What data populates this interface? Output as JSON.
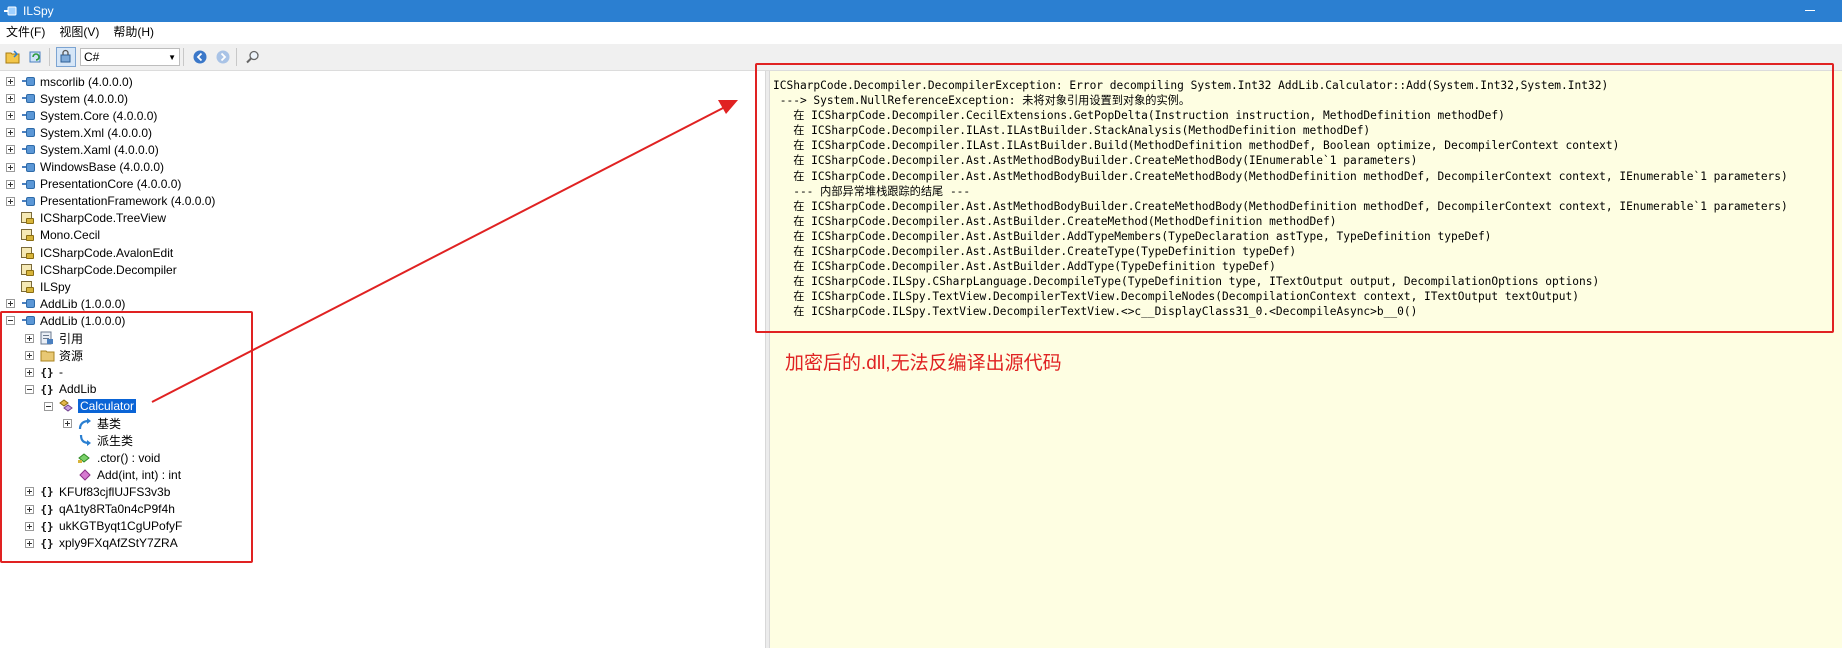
{
  "window": {
    "title": "ILSpy",
    "colors": {
      "titlebar": "#2b7fd1",
      "selection": "#0a64d6",
      "annotation": "#e02222",
      "code_background": "#fefee2"
    }
  },
  "menu": {
    "items": [
      "文件(F)",
      "视图(V)",
      "帮助(H)"
    ]
  },
  "toolbar": {
    "icons": [
      "open-icon",
      "reload-icon",
      "show-public-only-icon",
      "back-icon",
      "forward-icon",
      "search-icon"
    ],
    "language": "C#"
  },
  "tree": {
    "items": [
      {
        "label": "mscorlib (4.0.0.0)",
        "level": 0,
        "icon": "assembly-icon",
        "expander": "plus"
      },
      {
        "label": "System (4.0.0.0)",
        "level": 0,
        "icon": "assembly-icon",
        "expander": "plus"
      },
      {
        "label": "System.Core (4.0.0.0)",
        "level": 0,
        "icon": "assembly-icon",
        "expander": "plus"
      },
      {
        "label": "System.Xml (4.0.0.0)",
        "level": 0,
        "icon": "assembly-icon",
        "expander": "plus"
      },
      {
        "label": "System.Xaml (4.0.0.0)",
        "level": 0,
        "icon": "assembly-icon",
        "expander": "plus"
      },
      {
        "label": "WindowsBase (4.0.0.0)",
        "level": 0,
        "icon": "assembly-icon",
        "expander": "plus"
      },
      {
        "label": "PresentationCore (4.0.0.0)",
        "level": 0,
        "icon": "assembly-icon",
        "expander": "plus"
      },
      {
        "label": "PresentationFramework (4.0.0.0)",
        "level": 0,
        "icon": "assembly-icon",
        "expander": "plus"
      },
      {
        "label": "ICSharpCode.TreeView",
        "level": 0,
        "icon": "assembly-warning-icon",
        "expander": "none"
      },
      {
        "label": "Mono.Cecil",
        "level": 0,
        "icon": "assembly-warning-icon",
        "expander": "none"
      },
      {
        "label": "ICSharpCode.AvalonEdit",
        "level": 0,
        "icon": "assembly-warning-icon",
        "expander": "none"
      },
      {
        "label": "ICSharpCode.Decompiler",
        "level": 0,
        "icon": "assembly-warning-icon",
        "expander": "none"
      },
      {
        "label": "ILSpy",
        "level": 0,
        "icon": "assembly-warning-icon",
        "expander": "none"
      },
      {
        "label": "AddLib (1.0.0.0)",
        "level": 0,
        "icon": "assembly-icon",
        "expander": "plus"
      },
      {
        "label": "AddLib (1.0.0.0)",
        "level": 0,
        "icon": "assembly-icon",
        "expander": "minus"
      },
      {
        "label": "引用",
        "level": 1,
        "icon": "references-icon",
        "expander": "plus"
      },
      {
        "label": "资源",
        "level": 1,
        "icon": "folder-icon",
        "expander": "plus"
      },
      {
        "label": "-",
        "level": 1,
        "icon": "namespace-icon",
        "expander": "plus"
      },
      {
        "label": "AddLib",
        "level": 1,
        "icon": "namespace-icon",
        "expander": "minus"
      },
      {
        "label": "Calculator",
        "level": 2,
        "icon": "class-icon",
        "expander": "minus",
        "selected": true
      },
      {
        "label": "基类",
        "level": 3,
        "icon": "base-types-icon",
        "expander": "plus"
      },
      {
        "label": "派生类",
        "level": 3,
        "icon": "derived-types-icon",
        "expander": "none"
      },
      {
        "label": ".ctor() : void",
        "level": 3,
        "icon": "constructor-icon",
        "expander": "none"
      },
      {
        "label": "Add(int, int) : int",
        "level": 3,
        "icon": "method-icon",
        "expander": "none"
      },
      {
        "label": "KFUf83cjflUJFS3v3b",
        "level": 1,
        "icon": "namespace-icon",
        "expander": "plus"
      },
      {
        "label": "qA1ty8RTa0n4cP9f4h",
        "level": 1,
        "icon": "namespace-icon",
        "expander": "plus"
      },
      {
        "label": "ukKGTByqt1CgUPofyF",
        "level": 1,
        "icon": "namespace-icon",
        "expander": "plus"
      },
      {
        "label": "xply9FXqAfZStY7ZRA",
        "level": 1,
        "icon": "namespace-icon",
        "expander": "plus"
      }
    ]
  },
  "code": {
    "lines": [
      "ICSharpCode.Decompiler.DecompilerException: Error decompiling System.Int32 AddLib.Calculator::Add(System.Int32,System.Int32)",
      " ---> System.NullReferenceException: 未将对象引用设置到对象的实例。",
      "   在 ICSharpCode.Decompiler.CecilExtensions.GetPopDelta(Instruction instruction, MethodDefinition methodDef)",
      "   在 ICSharpCode.Decompiler.ILAst.ILAstBuilder.StackAnalysis(MethodDefinition methodDef)",
      "   在 ICSharpCode.Decompiler.ILAst.ILAstBuilder.Build(MethodDefinition methodDef, Boolean optimize, DecompilerContext context)",
      "   在 ICSharpCode.Decompiler.Ast.AstMethodBodyBuilder.CreateMethodBody(IEnumerable`1 parameters)",
      "   在 ICSharpCode.Decompiler.Ast.AstMethodBodyBuilder.CreateMethodBody(MethodDefinition methodDef, DecompilerContext context, IEnumerable`1 parameters)",
      "   --- 内部异常堆栈跟踪的结尾 ---",
      "   在 ICSharpCode.Decompiler.Ast.AstMethodBodyBuilder.CreateMethodBody(MethodDefinition methodDef, DecompilerContext context, IEnumerable`1 parameters)",
      "   在 ICSharpCode.Decompiler.Ast.AstBuilder.CreateMethod(MethodDefinition methodDef)",
      "   在 ICSharpCode.Decompiler.Ast.AstBuilder.AddTypeMembers(TypeDeclaration astType, TypeDefinition typeDef)",
      "   在 ICSharpCode.Decompiler.Ast.AstBuilder.CreateType(TypeDefinition typeDef)",
      "   在 ICSharpCode.Decompiler.Ast.AstBuilder.AddType(TypeDefinition typeDef)",
      "   在 ICSharpCode.ILSpy.CSharpLanguage.DecompileType(TypeDefinition type, ITextOutput output, DecompilationOptions options)",
      "   在 ICSharpCode.ILSpy.TextView.DecompilerTextView.DecompileNodes(DecompilationContext context, ITextOutput textOutput)",
      "   在 ICSharpCode.ILSpy.TextView.DecompilerTextView.<>c__DisplayClass31_0.<DecompileAsync>b__0()"
    ]
  },
  "annotation": {
    "text": "加密后的.dll,无法反编译出源代码"
  }
}
